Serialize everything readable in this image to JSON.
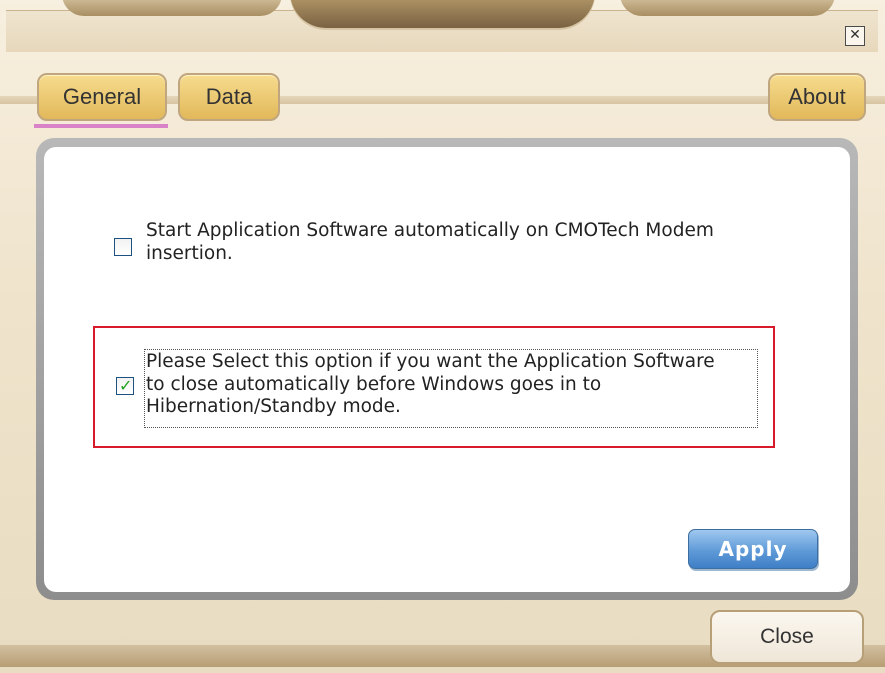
{
  "window": {
    "close_icon": "close-icon"
  },
  "tabs": [
    {
      "label": "General",
      "active": true
    },
    {
      "label": "Data",
      "active": false
    },
    {
      "label": "About",
      "active": false
    }
  ],
  "options": [
    {
      "text_line1": "Start Application Software automatically on CMOTech Modem",
      "text_line2": "insertion.",
      "checked": false
    },
    {
      "text_line1": "Please Select this option if you want the Application Software",
      "text_line2": "to close automatically before Windows goes in to",
      "text_line3": "Hibernation/Standby mode.",
      "checked": true
    }
  ],
  "buttons": {
    "apply": "Apply",
    "close": "Close"
  },
  "colors": {
    "accent_tab": "#e2b85a",
    "highlight": "#d81b2a",
    "apply_blue": "#5f9ad8",
    "tab_underline": "#d982c8"
  }
}
